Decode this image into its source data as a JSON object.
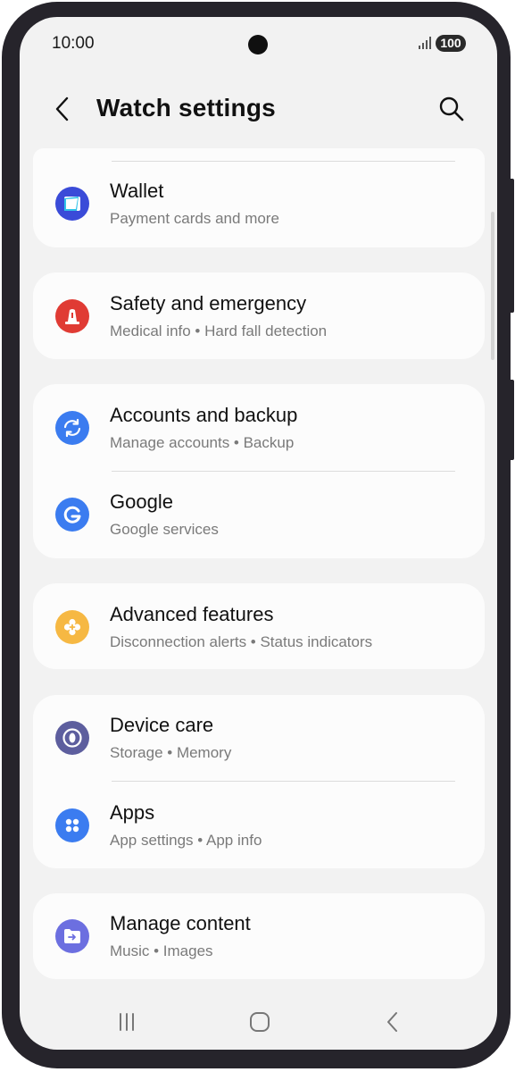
{
  "status_bar": {
    "time": "10:00",
    "battery": "100",
    "signal_icon": "signal-icon",
    "camera": "camera-cutout"
  },
  "app_bar": {
    "title": "Watch settings",
    "back_icon": "back-arrow-icon",
    "search_icon": "search-icon"
  },
  "groups": [
    {
      "items": [
        {
          "title": "Wallet",
          "subtitle": "Payment cards and more",
          "icon": "wallet-icon",
          "icon_color": "#3a4bd8"
        }
      ]
    },
    {
      "items": [
        {
          "title": "Safety and emergency",
          "subtitle": "Medical info • Hard fall detection",
          "icon": "siren-icon",
          "icon_color": "#e03b34"
        }
      ]
    },
    {
      "items": [
        {
          "title": "Accounts and backup",
          "subtitle": "Manage accounts • Backup",
          "icon": "sync-icon",
          "icon_color": "#3b7cf0"
        },
        {
          "title": "Google",
          "subtitle": "Google services",
          "icon": "google-icon",
          "icon_color": "#3b7cf0"
        }
      ]
    },
    {
      "items": [
        {
          "title": "Advanced features",
          "subtitle": "Disconnection alerts • Status indicators",
          "icon": "gear-plus-icon",
          "icon_color": "#f6b843"
        }
      ]
    },
    {
      "items": [
        {
          "title": "Device care",
          "subtitle": "Storage • Memory",
          "icon": "device-care-icon",
          "icon_color": "#5d5e9e"
        },
        {
          "title": "Apps",
          "subtitle": "App settings • App info",
          "icon": "apps-icon",
          "icon_color": "#3b7cf0"
        }
      ]
    },
    {
      "items": [
        {
          "title": "Manage content",
          "subtitle": "Music • Images",
          "icon": "folder-icon",
          "icon_color": "#6c6fe0"
        }
      ]
    }
  ],
  "nav_bar": {
    "recents_icon": "recents-icon",
    "home_icon": "home-icon",
    "back_icon": "nav-back-icon"
  }
}
